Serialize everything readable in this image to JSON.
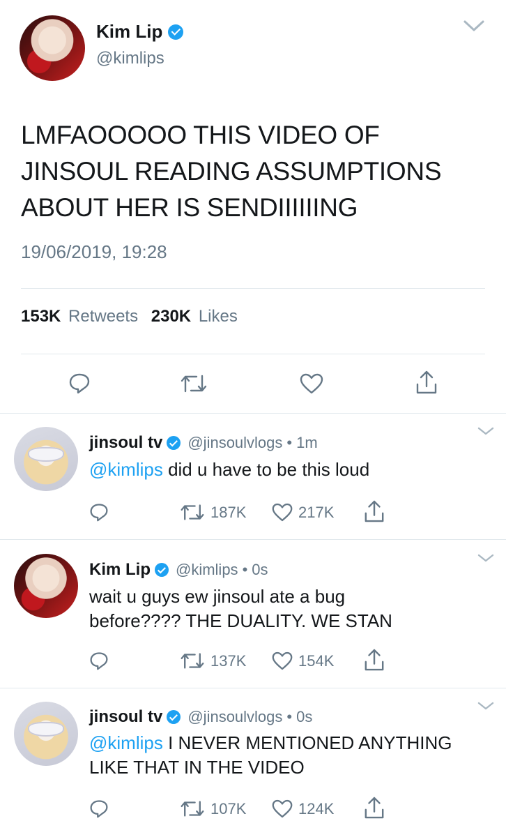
{
  "tweet": {
    "author_name": "Kim Lip",
    "author_handle": "@kimlips",
    "text_lines": [
      "LMFAOOOOO THIS VIDEO OF",
      "JINSOUL READING ASSUMPTIONS",
      "ABOUT HER IS SENDIIIIIING"
    ],
    "timestamp": "19/06/2019, 19:28",
    "retweets_count": "153K",
    "retweets_label": "Retweets",
    "likes_count": "230K",
    "likes_label": "Likes"
  },
  "replies": [
    {
      "name": "jinsoul tv",
      "handle": "@jinsoulvlogs",
      "time": "1m",
      "mention": "@kimlips",
      "text_lines": [
        " did u have to be this loud"
      ],
      "retweets": "187K",
      "likes": "217K"
    },
    {
      "name": "Kim Lip",
      "handle": "@kimlips",
      "time": "0s",
      "mention": "",
      "text_lines": [
        "wait u guys ew jinsoul ate a bug",
        "before???? THE DUALITY. WE STAN"
      ],
      "retweets": "137K",
      "likes": "154K"
    },
    {
      "name": "jinsoul tv",
      "handle": "@jinsoulvlogs",
      "time": "0s",
      "mention": "@kimlips",
      "text_lines": [
        " I NEVER MENTIONED ANYTHING",
        "LIKE THAT IN THE VIDEO"
      ],
      "retweets": "107K",
      "likes": "124K"
    }
  ],
  "separator": "•",
  "icons": {
    "reply": "reply-icon",
    "retweet": "retweet-icon",
    "like": "heart-icon",
    "share": "share-icon",
    "menu": "chevron-down-icon",
    "verified": "verified-badge-icon"
  },
  "colors": {
    "accent": "#1da1f2",
    "text": "#14171a",
    "secondary": "#657786",
    "divider": "#e1e8ed"
  }
}
